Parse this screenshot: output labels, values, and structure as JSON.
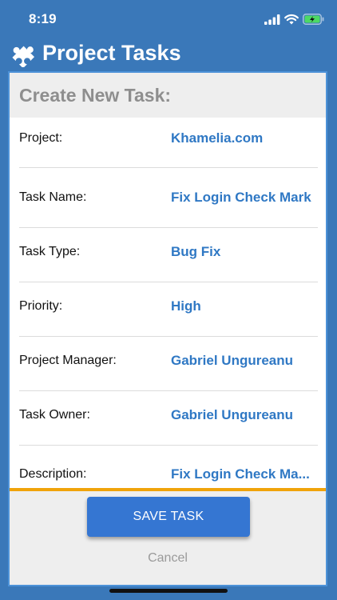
{
  "status_bar": {
    "time": "8:19",
    "icons": [
      "signal-icon",
      "wifi-icon",
      "battery-icon"
    ],
    "battery_charging": true
  },
  "header": {
    "icon": "puzzle-icon",
    "title": "Project Tasks"
  },
  "card": {
    "title": "Create New Task:",
    "fields": [
      {
        "label": "Project:",
        "value": "Khamelia.com"
      },
      {
        "label": "Task Name:",
        "value": "Fix Login Check Mark"
      },
      {
        "label": "Task Type:",
        "value": "Bug Fix"
      },
      {
        "label": "Priority:",
        "value": "High"
      },
      {
        "label": "Project Manager:",
        "value": "Gabriel Ungureanu"
      },
      {
        "label": "Task Owner:",
        "value": "Gabriel Ungureanu"
      },
      {
        "label": "Description:",
        "value": "Fix Login Check Ma..."
      }
    ]
  },
  "actions": {
    "save_label": "SAVE TASK",
    "cancel_label": "Cancel"
  },
  "colors": {
    "header_background": "#3a78b9",
    "card_border": "#4d92d8",
    "value_text": "#2f78c4",
    "save_button": "#3576d2",
    "scroll_indicator": "#f0a30a",
    "muted_text": "#9a9a9a"
  }
}
